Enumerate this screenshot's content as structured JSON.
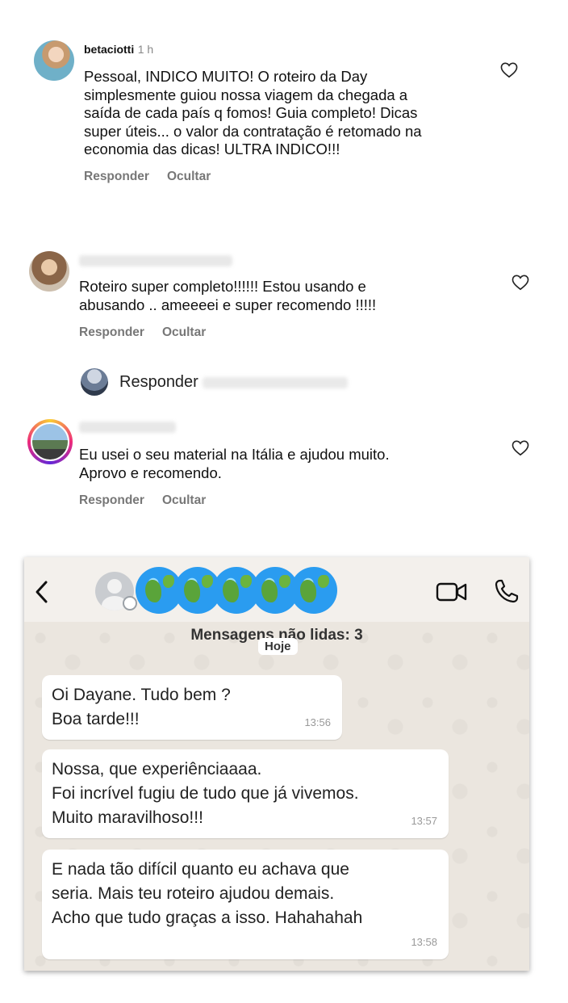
{
  "comments": [
    {
      "username": "betaciotti",
      "time": "1 h",
      "text": "Pessoal, INDICO MUITO! O roteiro da Day\nsimplesmente guiou nossa viagem da chegada a\nsaída de cada país q fomos! Guia completo! Dicas\nsuper úteis... o valor da contratação é retomado na\neconomia das dicas! ULTRA INDICO!!!",
      "reply": "Responder",
      "hide": "Ocultar"
    },
    {
      "username": "",
      "text": "Roteiro super completo!!!!!! Estou usando e\nabusando .. ameeeei e super recomendo !!!!!",
      "reply": "Responder",
      "hide": "Ocultar"
    },
    {
      "username": "",
      "text": "Eu usei o seu material na Itália e ajudou muito.\nAprovo e recomendo.",
      "reply": "Responder",
      "hide": "Ocultar"
    }
  ],
  "reply_prompt": {
    "label": "Responder"
  },
  "whatsapp": {
    "unread_banner": "Mensagens não lidas: 3",
    "date_chip": "Hoje",
    "messages": [
      {
        "text": "Oi Dayane. Tudo bem ?\nBoa tarde!!!",
        "time": "13:56"
      },
      {
        "text": "Nossa, que experiênciaaaa.\nFoi incrível fugiu de tudo que já vivemos.\nMuito maravilhoso!!!",
        "time": "13:57"
      },
      {
        "text": "E nada tão difícil quanto eu achava que\nseria. Mais teu roteiro ajudou demais.\nAcho que tudo graças a isso. Hahahahah",
        "time": "13:58"
      }
    ]
  },
  "icons": [
    "heart-icon",
    "back-icon",
    "contact-avatar-icon",
    "globe-icon",
    "video-call-icon",
    "phone-icon"
  ]
}
